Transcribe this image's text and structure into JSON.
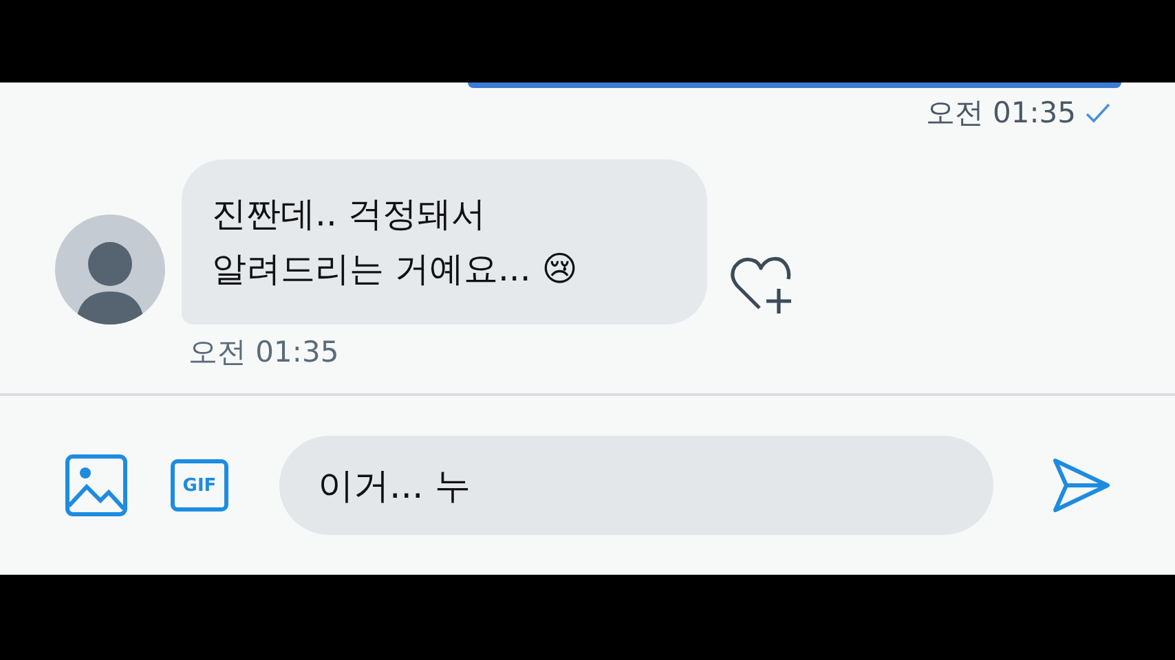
{
  "sent_message": {
    "time": "오전 01:35"
  },
  "received_message": {
    "lines": [
      "진짠데.. 걱정돼서",
      "알려드리는 거예요... 😢"
    ],
    "time": "오전 01:35"
  },
  "composer": {
    "gif_label": "GIF",
    "value": "이거... 누"
  }
}
